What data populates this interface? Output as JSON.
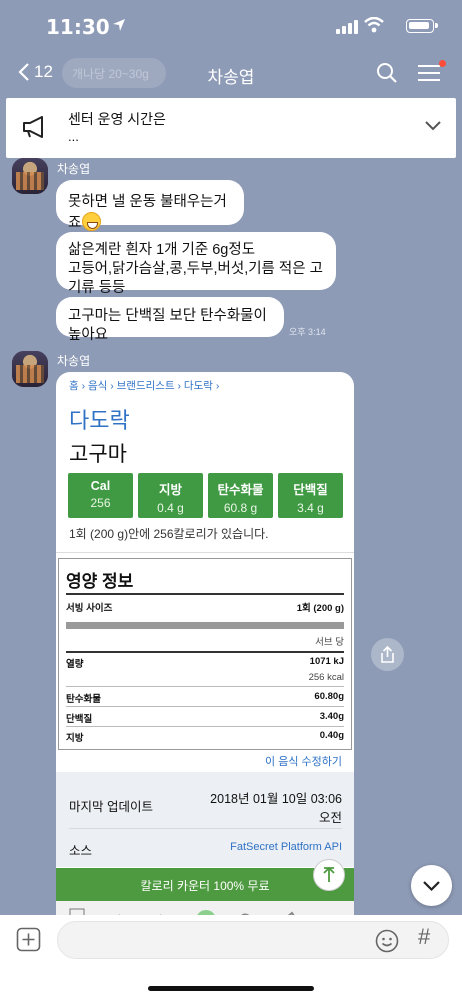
{
  "status": {
    "time": "11:30"
  },
  "header": {
    "back_count": "12",
    "faded_text": "개나당 20~30g",
    "title": "차송엽"
  },
  "notice": {
    "title": "센터 운영 시간은",
    "body": "..."
  },
  "messages": {
    "sender1": "차송엽",
    "m1": "못하면 낼 운동 불태우는거죠",
    "m2_line1": "삶은계란 흰자 1개 기준 6g정도",
    "m2_line2": "고등어,닭가슴살,콩,두부,버섯,기름 적은 고기류 등등",
    "m3": "고구마는 단백질 보단 탄수화물이 높아요",
    "time": "오후 3:14",
    "sender2": "차송엽"
  },
  "card": {
    "breadcrumb": "홈 › 음식 › 브랜드리스트 › 다도락 ›",
    "brand": "다도락",
    "food": "고구마",
    "boxes": [
      {
        "label": "Cal",
        "value": "256"
      },
      {
        "label": "지방",
        "value": "0.4 g"
      },
      {
        "label": "탄수화물",
        "value": "60.8 g"
      },
      {
        "label": "단백질",
        "value": "3.4 g"
      }
    ],
    "summary": "1회 (200 g)안에 256칼로리가 있습니다.",
    "panel_title": "영양 정보",
    "serving_label": "서빙 사이즈",
    "serving_value": "1회 (200 g)",
    "per_serving": "서브 당",
    "energy_label": "열량",
    "energy_kj": "1071 kJ",
    "energy_kcal": "256 kcal",
    "carb_label": "탄수화물",
    "carb_value": "60.80g",
    "protein_label": "단백질",
    "protein_value": "3.40g",
    "fat_label": "지방",
    "fat_value": "0.40g",
    "edit_link": "이 음식 수정하기",
    "updated_label": "마지막 업데이트",
    "updated_date": "2018년 01월 10일 03:06",
    "updated_ampm": "오전",
    "source_label": "소스",
    "source_value": "FatSecret Platform API",
    "promo": "칼로리 카운터 100% 무료"
  },
  "colors": {
    "chat_bg": "#8e9bb6",
    "green": "#3f9a43",
    "link": "#2f72c6"
  }
}
